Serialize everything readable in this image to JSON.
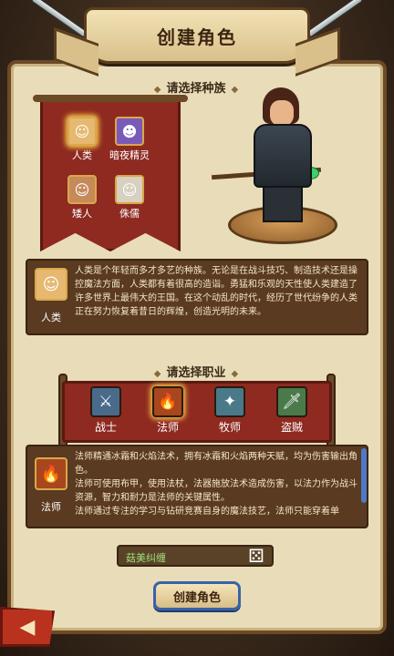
{
  "header": {
    "title": "创建角色"
  },
  "race_section": {
    "title": "请选择种族",
    "races": [
      {
        "label": "人类",
        "icon": "human-portrait-icon",
        "selected": true
      },
      {
        "label": "暗夜精灵",
        "icon": "night-elf-portrait-icon",
        "selected": false
      },
      {
        "label": "矮人",
        "icon": "dwarf-portrait-icon",
        "selected": false
      },
      {
        "label": "侏儒",
        "icon": "gnome-portrait-icon",
        "selected": false
      }
    ]
  },
  "race_description": {
    "label": "人类",
    "text": "人类是个年轻而多才多艺的种族。无论是在战斗技巧、制造技术还是操控魔法方面，人类都有着很高的造诣。勇猛和乐观的天性使人类建造了许多世界上最伟大的王国。在这个动乱的时代，经历了世代纷争的人类正在努力恢复着昔日的辉煌，创造光明的未来。"
  },
  "class_section": {
    "title": "请选择职业",
    "classes": [
      {
        "label": "战士",
        "icon": "sword-icon",
        "selected": false
      },
      {
        "label": "法师",
        "icon": "fire-staff-icon",
        "selected": true
      },
      {
        "label": "牧师",
        "icon": "holy-icon",
        "selected": false
      },
      {
        "label": "盗贼",
        "icon": "dagger-icon",
        "selected": false
      }
    ]
  },
  "class_description": {
    "label": "法师",
    "lines": [
      "法师精通冰霜和火焰法术，拥有冰霜和火焰两种天赋，均为伤害输出角色。",
      "法师可使用布甲，使用法杖，法器施放法术造成伤害，以法力作为战斗资源，智力和耐力是法师的关键属性。",
      "法师通过专注的学习与钻研竞赛自身的魔法技艺，法师只能穿着单"
    ]
  },
  "name_field": {
    "value": "菇美纠缠"
  },
  "buttons": {
    "create": "创建角色",
    "back": "◀"
  },
  "colors": {
    "banner_red": "#8e2a20",
    "parchment": "#e9dcb9",
    "accent_blue": "#3a62a8"
  }
}
